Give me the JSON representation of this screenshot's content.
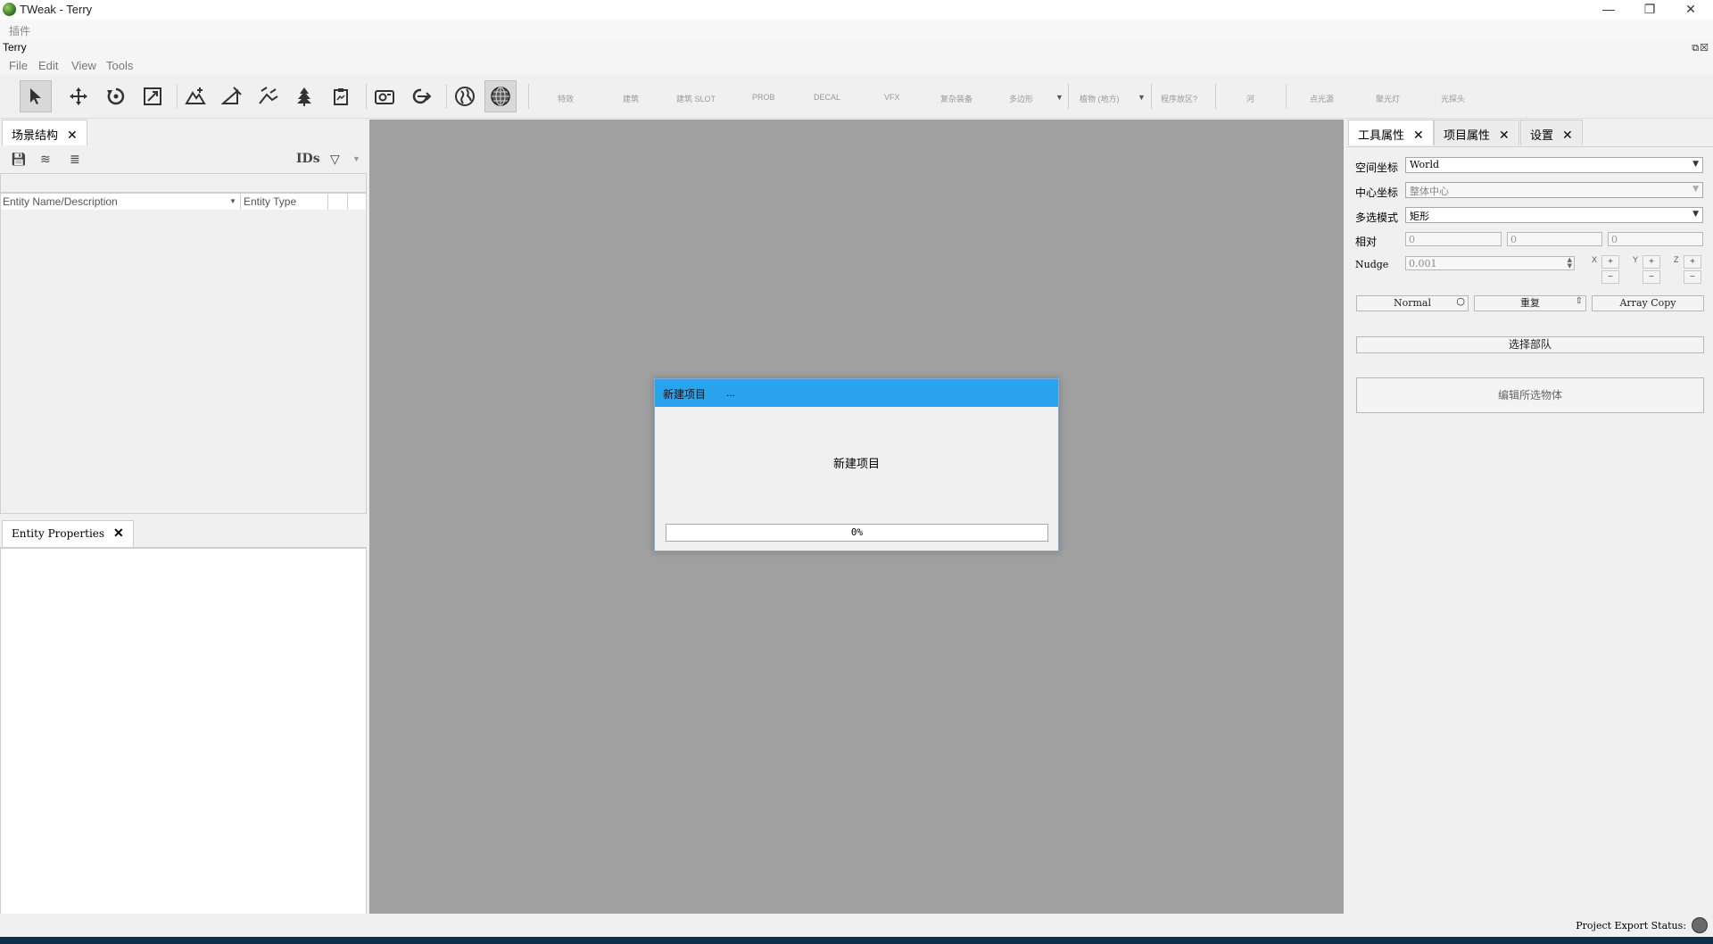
{
  "window": {
    "title": "TWeak - Terry",
    "minimize": "—",
    "restore": "❐",
    "close": "✕"
  },
  "menu_plugins": "插件",
  "terry_label": "Terry",
  "terry_ctrls": "⧉☒",
  "menubar": [
    "File",
    "Edit",
    "View",
    "Tools"
  ],
  "toolbar": {
    "labels": [
      "特效",
      "建筑",
      "建筑 SLOT",
      "PROB",
      "DECAL",
      "VFX",
      "复杂装备",
      "多边形",
      "植物 (地方)",
      "程序放区?",
      "河",
      "点光源",
      "聚光灯",
      "光探头"
    ]
  },
  "scene_panel": {
    "tab_label": "场景结构",
    "ids_label": "IDs",
    "columns": [
      "Entity Name/Description",
      "Entity Type"
    ]
  },
  "props_panel": {
    "tab_label": "Entity Properties"
  },
  "dialog": {
    "title": "新建项目",
    "title_dots": "...",
    "message": "新建项目",
    "progress_text": "0%",
    "progress": 0
  },
  "right_panel": {
    "tabs": [
      "工具属性",
      "项目属性",
      "设置"
    ],
    "space_label": "空间坐标",
    "space_value": "World",
    "center_label": "中心坐标",
    "center_value": "整体中心",
    "multi_label": "多选模式",
    "multi_value": "矩形",
    "relative_label": "相对",
    "relative_values": [
      "0",
      "0",
      "0"
    ],
    "nudge_label": "Nudge",
    "nudge_value": "0.001",
    "axes": [
      "X",
      "Y",
      "Z"
    ],
    "plus": "+",
    "minus": "−",
    "normal_btn": "Normal",
    "repeat_btn": "重复",
    "array_btn": "Array Copy",
    "select_team_btn": "选择部队",
    "edit_selected_btn": "编辑所选物体"
  },
  "status": {
    "text": "Project Export Status:"
  }
}
